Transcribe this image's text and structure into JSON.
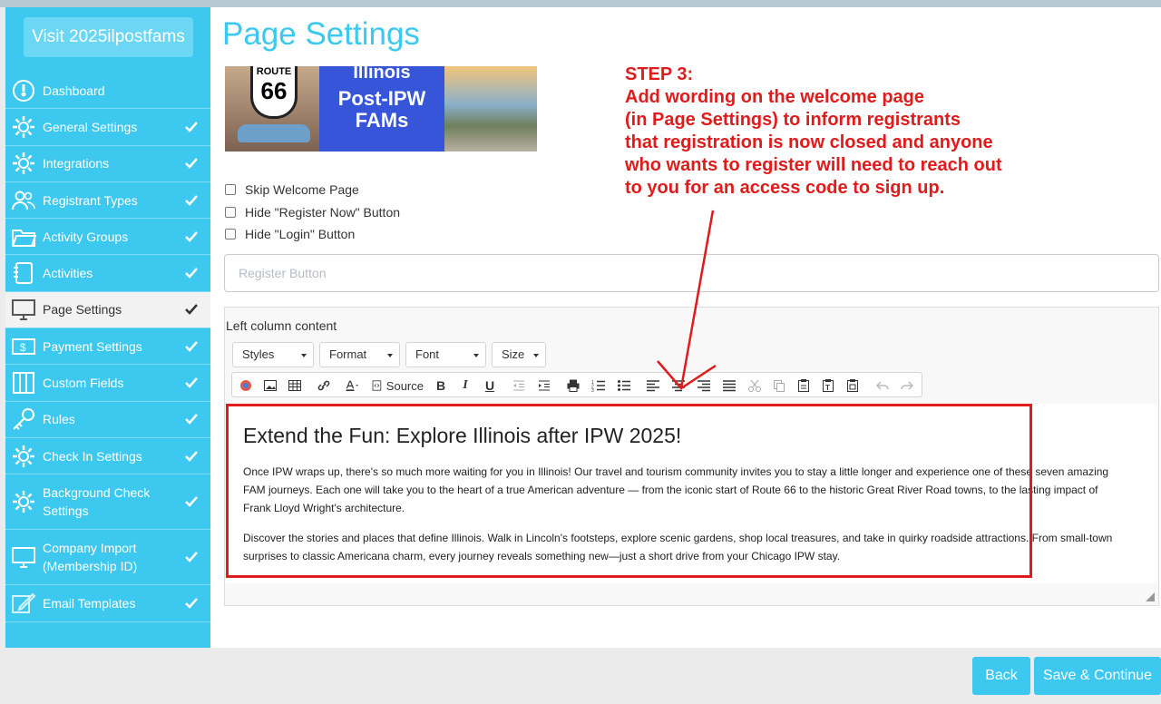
{
  "sidebar": {
    "event_name": "Visit 2025ilpostfams",
    "items": [
      {
        "label": "Dashboard",
        "icon": "dashboard-icon",
        "checked": false
      },
      {
        "label": "General Settings",
        "icon": "gear-icon",
        "checked": true
      },
      {
        "label": "Integrations",
        "icon": "gear-icon",
        "checked": true
      },
      {
        "label": "Registrant Types",
        "icon": "users-icon",
        "checked": true
      },
      {
        "label": "Activity Groups",
        "icon": "folder-icon",
        "checked": true
      },
      {
        "label": "Activities",
        "icon": "notebook-icon",
        "checked": true
      },
      {
        "label": "Page Settings",
        "icon": "monitor-icon",
        "checked": true,
        "active": true
      },
      {
        "label": "Payment Settings",
        "icon": "money-icon",
        "checked": true
      },
      {
        "label": "Custom Fields",
        "icon": "columns-icon",
        "checked": true
      },
      {
        "label": "Rules",
        "icon": "key-icon",
        "checked": true
      },
      {
        "label": "Check In Settings",
        "icon": "gear-icon",
        "checked": true
      },
      {
        "label": "Background Check Settings",
        "icon": "gear-icon",
        "checked": true
      },
      {
        "label": "Company Import (Membership ID)",
        "icon": "monitor-icon",
        "checked": true
      },
      {
        "label": "Email Templates",
        "icon": "pencil-icon",
        "checked": true
      }
    ]
  },
  "page": {
    "title": "Page Settings",
    "banner": {
      "route_text": "ROUTE",
      "route_number": "66",
      "state": "Illinois",
      "headline": "Post-IPW FAMs"
    },
    "checkboxes": [
      {
        "label": "Skip Welcome Page"
      },
      {
        "label": "Hide \"Register Now\" Button"
      },
      {
        "label": "Hide \"Login\" Button"
      }
    ],
    "register_button_placeholder": "Register Button",
    "left_column_label": "Left column content",
    "combos": [
      "Styles",
      "Format",
      "Font",
      "Size"
    ],
    "toolbar_source": "Source",
    "content": {
      "heading": "Extend the Fun: Explore Illinois after IPW 2025!",
      "p1": "Once IPW wraps up, there's so much more waiting for you in Illinois! Our travel and tourism community invites you to stay a little longer and experience one of these seven amazing FAM journeys. Each one will take you to the heart of a true American adventure — from the iconic start of Route 66 to the historic Great River Road towns, to the lasting impact of Frank Lloyd Wright's architecture.",
      "p2": "Discover the stories and places that define Illinois. Walk in Lincoln's footsteps, explore scenic gardens, shop local treasures, and take in quirky roadside attractions. From small-town surprises to classic Americana charm, every journey reveals something new—just a short drive from your Chicago IPW stay."
    }
  },
  "annotation": {
    "step": "STEP 3:",
    "lines": [
      "Add wording on the welcome page",
      "(in Page Settings) to inform registrants",
      "that registration is now closed and anyone",
      "who wants to register will need to reach out",
      "to you for an access code to sign up."
    ],
    "color": "#e01b1b"
  },
  "footer": {
    "back": "Back",
    "save": "Save & Continue"
  },
  "colors": {
    "accent": "#3cc8ef",
    "annotation": "#e01b1b"
  }
}
